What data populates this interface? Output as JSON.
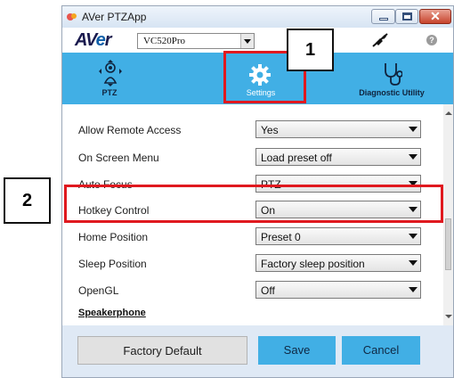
{
  "window": {
    "title": "AVer PTZApp"
  },
  "header": {
    "logo_text": "AVer",
    "model_value": "VC520Pro"
  },
  "nav": [
    {
      "label": "PTZ",
      "icon": "ptz-icon"
    },
    {
      "label": "Settings",
      "icon": "gear-icon",
      "active": true
    },
    {
      "label": "Diagnostic Utility",
      "icon": "stethoscope-icon"
    }
  ],
  "settings": [
    {
      "label": "Allow Remote Access",
      "value": "Yes"
    },
    {
      "label": "On Screen Menu",
      "value": "Load preset off"
    },
    {
      "label": "Auto Focus",
      "value": "PTZ"
    },
    {
      "label": "Hotkey Control",
      "value": "On"
    },
    {
      "label": "Home Position",
      "value": "Preset 0"
    },
    {
      "label": "Sleep Position",
      "value": "Factory sleep position"
    },
    {
      "label": "OpenGL",
      "value": "Off"
    }
  ],
  "section": {
    "speakerphone": "Speakerphone"
  },
  "buttons": {
    "factory_default": "Factory Default",
    "save": "Save",
    "cancel": "Cancel"
  },
  "callouts": {
    "one": "1",
    "two": "2"
  },
  "colors": {
    "accent": "#41afe5",
    "highlight": "#e0191f",
    "window_bg": "#dfe9f5"
  }
}
